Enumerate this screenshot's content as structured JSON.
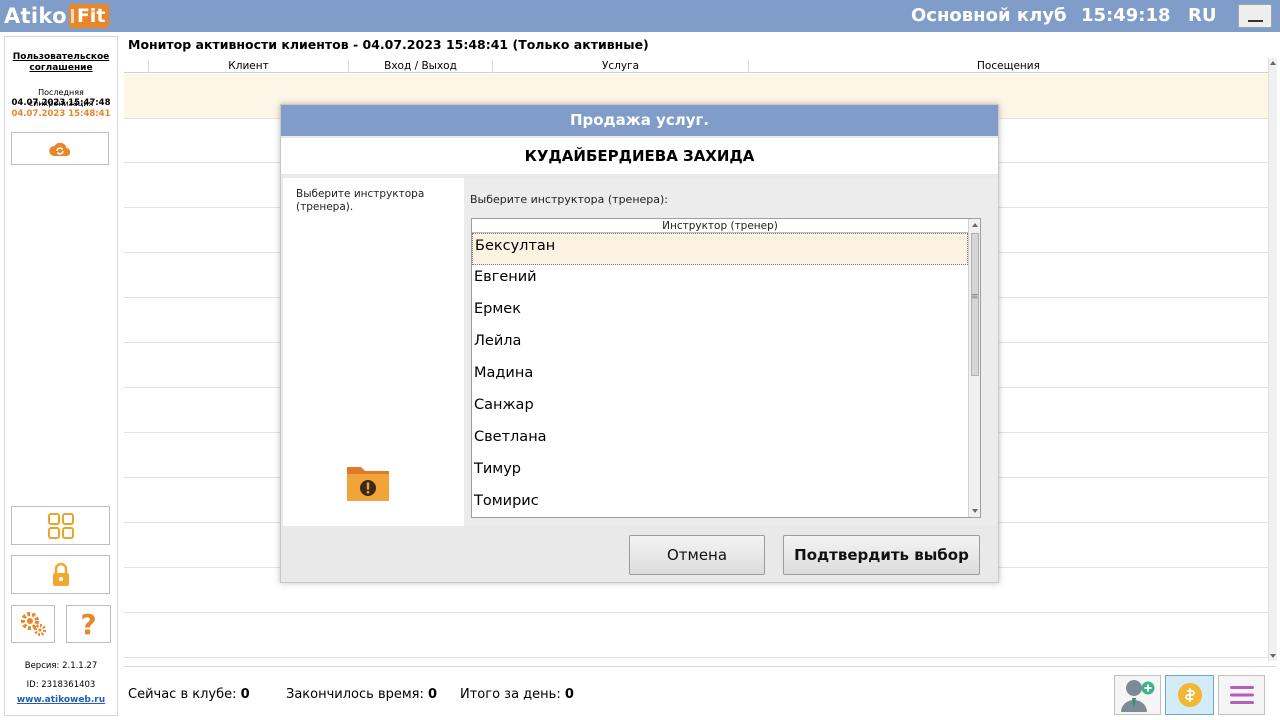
{
  "topbar": {
    "logo_left": "Atiko",
    "logo_right": "Fit",
    "club": "Основной клуб",
    "time": "15:49:18",
    "lang": "RU"
  },
  "sidebar": {
    "agreement": "Пользовательское соглашение",
    "sync_label": "Последняя синхронизация",
    "sync_time1": "04.07.2023 15:47:48",
    "sync_time2": "04.07.2023 15:48:41",
    "version": "Версия: 2.1.1.27",
    "id": "ID: 2318361403",
    "site": "www.atikoweb.ru",
    "icons": [
      "cloud-sync-icon",
      "grid-icon",
      "lock-icon",
      "gear-icon",
      "help-icon"
    ]
  },
  "main": {
    "title": "Монитор активности клиентов - 04.07.2023 15:48:41 (Только активные)",
    "columns": [
      "Клиент",
      "Вход / Выход",
      "Услуга",
      "Посещения"
    ]
  },
  "bottom": {
    "in_club_label": "Сейчас в клубе:",
    "in_club_value": "0",
    "time_over_label": "Закончилось время:",
    "time_over_value": "0",
    "total_label": "Итого за день:",
    "total_value": "0"
  },
  "modal": {
    "title": "Продажа услуг.",
    "client": "КУДАЙБЕРДИЕВА ЗАХИДА",
    "left_hint": "Выберите инструктора (тренера).",
    "right_hint": "Выберите инструктора (тренера):",
    "list_header": "Инструктор (тренер)",
    "instructors": [
      "Бексултан",
      "Евгений",
      "Ермек",
      "Лейла",
      "Мадина",
      "Санжар",
      "Светлана",
      "Тимур",
      "Томирис"
    ],
    "cancel": "Отмена",
    "confirm": "Подтвердить выбор"
  },
  "colors": {
    "header_blue": "#7f9dc8",
    "accent_orange": "#e8862a",
    "selected_row": "#fdf3e2"
  }
}
